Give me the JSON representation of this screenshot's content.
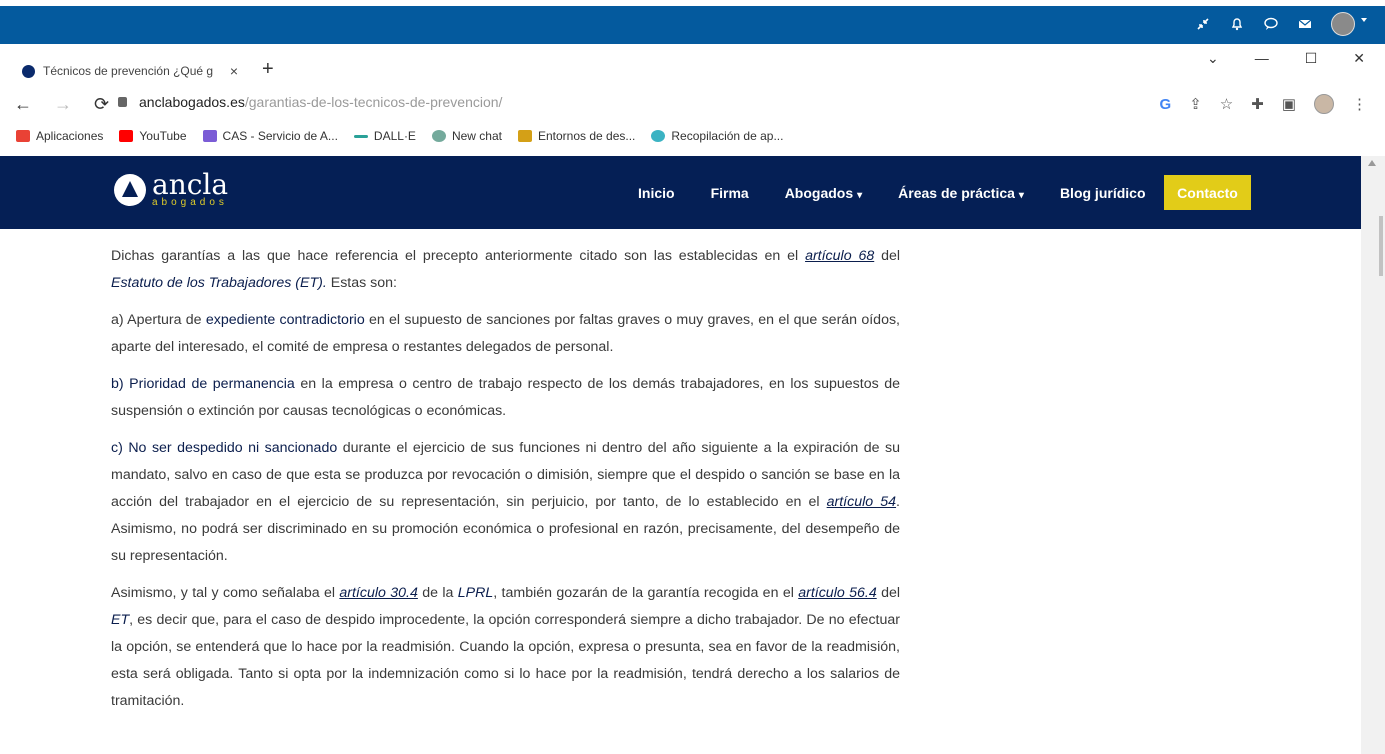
{
  "app_bar": {
    "icons": [
      "minimize-arrows-icon",
      "bell-icon",
      "chat-icon",
      "mail-icon"
    ],
    "avatar": "user-avatar"
  },
  "browser": {
    "tab": {
      "title": "Técnicos de prevención ¿Qué ga",
      "close": "×"
    },
    "new_tab": "+",
    "window_controls": {
      "minimize": "—",
      "maximize": "☐",
      "close": "✕",
      "dropdown": "⌄"
    },
    "nav": {
      "back": "←",
      "forward": "→",
      "reload": "⟳"
    },
    "url": {
      "host": "anclabogados.es",
      "path": "/garantias-de-los-tecnicos-de-prevencion/"
    },
    "bookmarks": [
      {
        "label": "Aplicaciones",
        "color": "#e94235"
      },
      {
        "label": "YouTube",
        "color": "#ff0000"
      },
      {
        "label": "CAS - Servicio de A...",
        "color": "#7b5cd6"
      },
      {
        "label": "DALL·E",
        "color": "#2aa198"
      },
      {
        "label": "New chat",
        "color": "#74aa9c"
      },
      {
        "label": "Entornos de des...",
        "color": "#d4a017"
      },
      {
        "label": "Recopilación de ap...",
        "color": "#3bb3c3"
      }
    ]
  },
  "site": {
    "logo": {
      "name": "ancla",
      "sub": "abogados"
    },
    "menu": [
      {
        "label": "Inicio",
        "dropdown": false
      },
      {
        "label": "Firma",
        "dropdown": false
      },
      {
        "label": "Abogados",
        "dropdown": true
      },
      {
        "label": "Áreas de práctica",
        "dropdown": true
      },
      {
        "label": "Blog jurídico",
        "dropdown": false
      }
    ],
    "cta": "Contacto"
  },
  "article": {
    "p1": {
      "a": "Dichas garantías a las que hace referencia el precepto anteriormente citado son las establecidas en el ",
      "link": "artículo 68",
      "b": " del ",
      "em": "Estatuto de los Trabajadores (ET).",
      "c": " Estas son:"
    },
    "p2": {
      "lead": "a) Apertura de ",
      "strong": "expediente contradictorio",
      "rest": " en el supuesto de sanciones por faltas graves o muy graves, en el que serán oídos, aparte del interesado, el comité de empresa o restantes delegados de personal."
    },
    "p3": {
      "strong": "b) Prioridad de permanencia",
      "rest": " en la empresa o centro de trabajo respecto de los demás trabajadores, en los supuestos de suspensión o extinción por causas tecnológicas o económicas."
    },
    "p4": {
      "strong": "c) No ser despedido ni sancionado",
      "rest": " durante el ejercicio de sus funciones ni dentro del año siguiente a la expiración de su mandato, salvo en caso de que esta se produzca por revocación o dimisión, siempre que el despido o sanción se base en la acción del trabajador en el ejercicio de su representación, sin perjuicio, por tanto, de lo establecido en el ",
      "link": "artículo 54",
      "rest2": ". Asimismo, no podrá ser discriminado en su promoción económica o profesional en razón, precisamente, del desempeño de su representación."
    },
    "p5": {
      "a": "Asimismo, y tal y como señalaba el ",
      "link1": "artículo 30.4",
      "b": " de la ",
      "em1": "LPRL",
      "c": ", también gozarán de la garantía recogida en el ",
      "link2": "artículo 56.4",
      "d": " del ",
      "em2": "ET",
      "e": ", es decir que, para el caso de despido improcedente, la opción corresponderá siempre a dicho trabajador. De no efectuar la opción, se entenderá que lo hace por la readmisión. Cuando la opción, expresa o presunta, sea en favor de la readmisión, esta será obligada. Tanto si opta por la indemnización como si lo hace por la readmisión, tendrá derecho a los salarios de tramitación."
    }
  }
}
